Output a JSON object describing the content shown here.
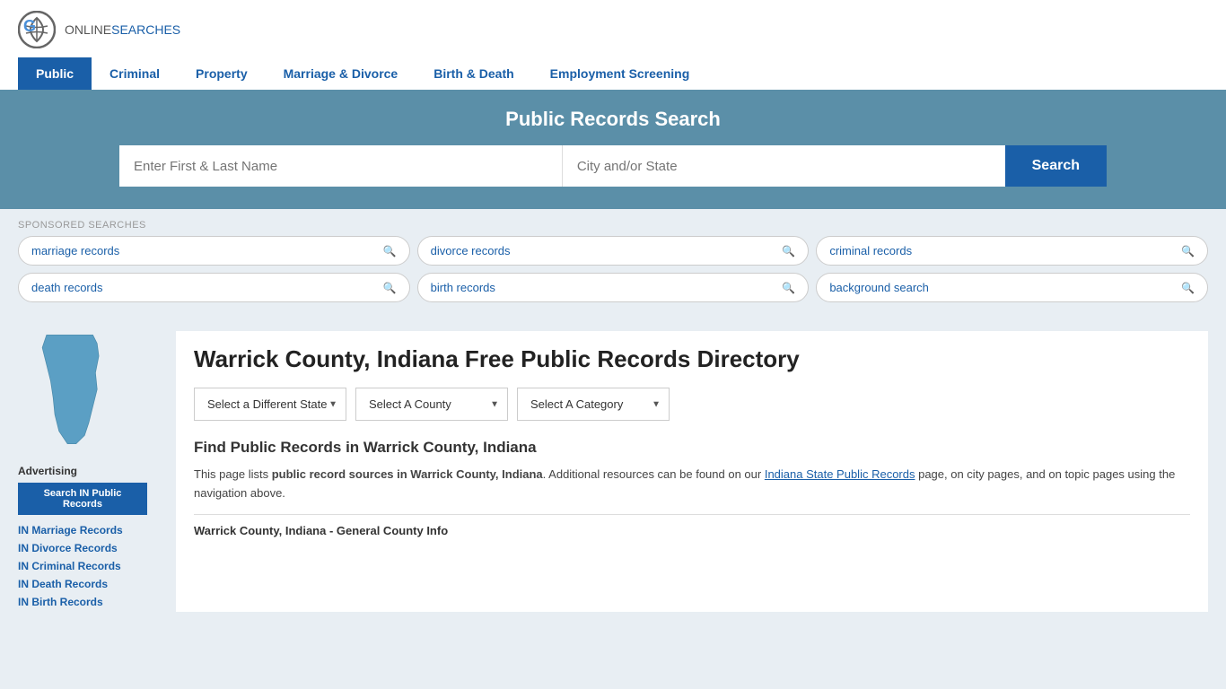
{
  "header": {
    "logo_online": "ONLINE",
    "logo_searches": "SEARCHES",
    "nav_items": [
      {
        "label": "Public",
        "active": true
      },
      {
        "label": "Criminal",
        "active": false
      },
      {
        "label": "Property",
        "active": false
      },
      {
        "label": "Marriage & Divorce",
        "active": false
      },
      {
        "label": "Birth & Death",
        "active": false
      },
      {
        "label": "Employment Screening",
        "active": false
      }
    ]
  },
  "hero": {
    "title": "Public Records Search",
    "name_placeholder": "Enter First & Last Name",
    "location_placeholder": "City and/or State",
    "search_button": "Search"
  },
  "sponsored": {
    "label": "SPONSORED SEARCHES",
    "pills": [
      {
        "label": "marriage records"
      },
      {
        "label": "divorce records"
      },
      {
        "label": "criminal records"
      },
      {
        "label": "death records"
      },
      {
        "label": "birth records"
      },
      {
        "label": "background search"
      }
    ]
  },
  "sidebar": {
    "advertising_label": "Advertising",
    "ad_button_label": "Search IN Public Records",
    "links": [
      {
        "label": "IN Marriage Records"
      },
      {
        "label": "IN Divorce Records"
      },
      {
        "label": "IN Criminal Records"
      },
      {
        "label": "IN Death Records"
      },
      {
        "label": "IN Birth Records"
      }
    ]
  },
  "main": {
    "page_title": "Warrick County, Indiana Free Public Records Directory",
    "selectors": {
      "state_label": "Select a Different State",
      "county_label": "Select A County",
      "category_label": "Select A Category"
    },
    "find_records_title": "Find Public Records in Warrick County, Indiana",
    "description_part1": "This page lists ",
    "description_bold": "public record sources in Warrick County, Indiana",
    "description_part2": ". Additional resources can be found on our ",
    "description_link": "Indiana State Public Records",
    "description_part3": " page, on city pages, and on topic pages using the navigation above.",
    "general_info": "Warrick County, Indiana - General County Info"
  }
}
